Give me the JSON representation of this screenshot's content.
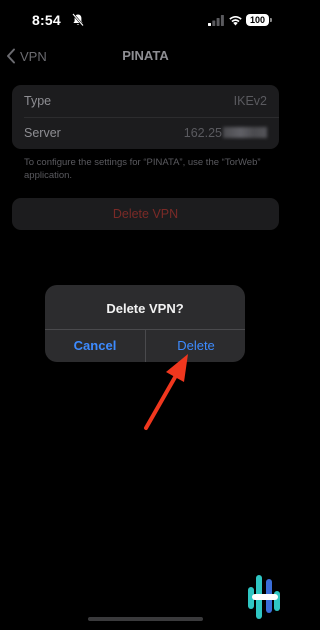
{
  "status_bar": {
    "time": "8:54",
    "battery": "100",
    "icons": [
      "bell-slash-icon",
      "signal-icon",
      "wifi-icon",
      "battery-icon"
    ]
  },
  "nav": {
    "back_label": "VPN",
    "title": "PINATA"
  },
  "details": {
    "type_label": "Type",
    "type_value": "IKEv2",
    "server_label": "Server",
    "server_value": "162.25"
  },
  "note": "To configure the settings for “PINATA”, use the “TorWeb” application.",
  "delete_vpn_label": "Delete VPN",
  "alert": {
    "title": "Delete VPN?",
    "cancel_label": "Cancel",
    "delete_label": "Delete"
  },
  "colors": {
    "background": "#000000",
    "card": "#1c1c1e",
    "alert_bg": "#2c2c2e",
    "accent_blue": "#3d8bff",
    "destructive_dimmed": "#7a2a27",
    "annotation_arrow": "#f0371e"
  }
}
